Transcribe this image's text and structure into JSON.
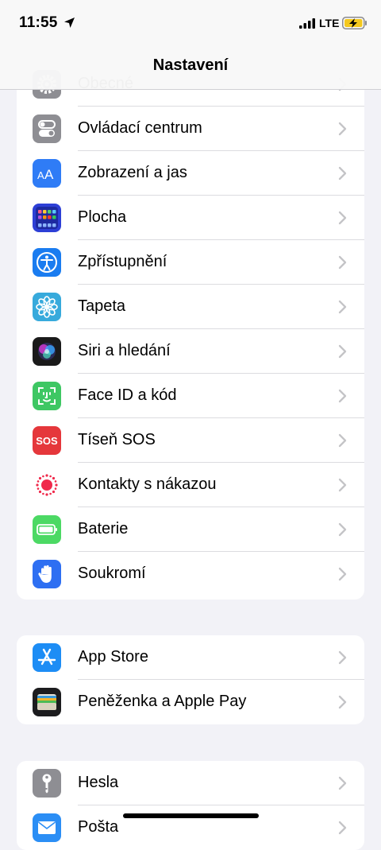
{
  "status": {
    "time": "11:55",
    "network": "LTE"
  },
  "nav": {
    "title": "Nastavení"
  },
  "groups": [
    {
      "items": [
        {
          "label": "Obecné",
          "icon": "gear-icon",
          "color": "#8e8e93"
        },
        {
          "label": "Ovládací centrum",
          "icon": "switches-icon",
          "color": "#8e8e93"
        },
        {
          "label": "Zobrazení a jas",
          "icon": "text-size-icon",
          "color": "#2f7cf6"
        },
        {
          "label": "Plocha",
          "icon": "home-screen-icon",
          "color": "#2d3fd6"
        },
        {
          "label": "Zpřístupnění",
          "icon": "accessibility-icon",
          "color": "#1a7cf0"
        },
        {
          "label": "Tapeta",
          "icon": "flower-icon",
          "color": "#37aadc"
        },
        {
          "label": "Siri a hledání",
          "icon": "siri-icon",
          "color": "#1a1a1a"
        },
        {
          "label": "Face ID a kód",
          "icon": "face-id-icon",
          "color": "#3ec763"
        },
        {
          "label": "Tíseň SOS",
          "icon": "sos-icon",
          "color": "#e5373b",
          "icon_text": "SOS"
        },
        {
          "label": "Kontakty s nákazou",
          "icon": "exposure-icon",
          "color": "#ffffff"
        },
        {
          "label": "Baterie",
          "icon": "battery-icon",
          "color": "#4cd964"
        },
        {
          "label": "Soukromí",
          "icon": "hand-icon",
          "color": "#2e6ff2"
        }
      ]
    },
    {
      "items": [
        {
          "label": "App Store",
          "icon": "app-store-icon",
          "color": "#1d8df5"
        },
        {
          "label": "Peněženka a Apple Pay",
          "icon": "wallet-icon",
          "color": "#1c1c1e"
        }
      ]
    },
    {
      "items": [
        {
          "label": "Hesla",
          "icon": "key-icon",
          "color": "#8e8e93"
        },
        {
          "label": "Pošta",
          "icon": "mail-icon",
          "color": "#2b8ef5"
        }
      ]
    }
  ]
}
